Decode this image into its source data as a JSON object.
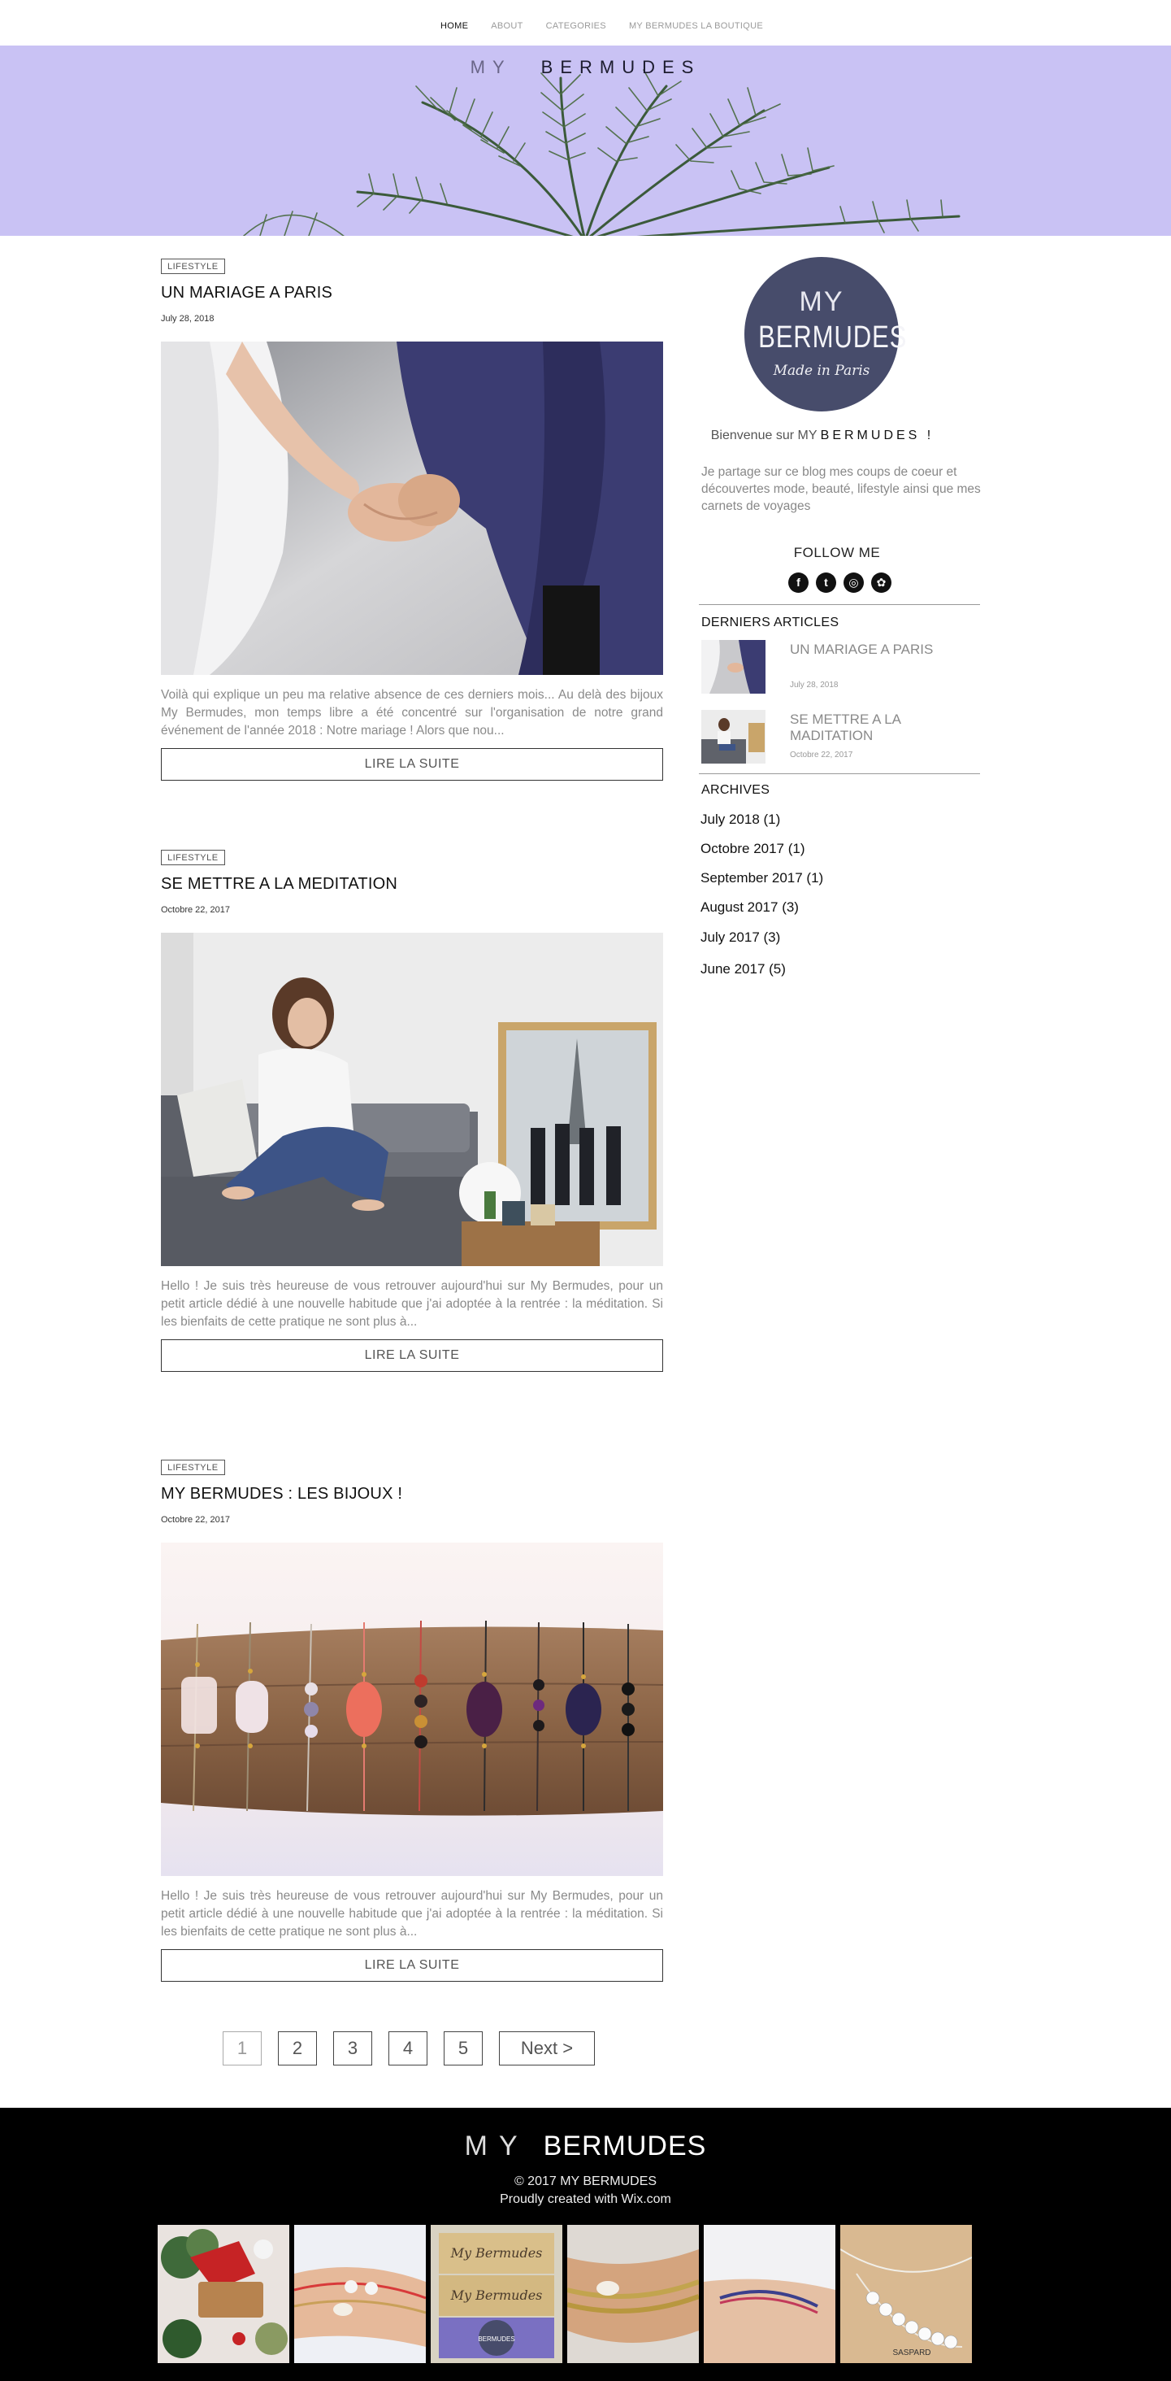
{
  "nav": {
    "items": [
      {
        "label": "HOME"
      },
      {
        "label": "ABOUT"
      },
      {
        "label": "CATEGORIES"
      },
      {
        "label": "MY BERMUDES LA BOUTIQUE"
      }
    ]
  },
  "hero": {
    "title_a": "MY",
    "title_b": "BERMUDES"
  },
  "posts": [
    {
      "category": "LIFESTYLE",
      "title": "UN MARIAGE A PARIS",
      "date": "July 28, 2018",
      "excerpt": "Voilà qui explique un peu ma relative absence de ces derniers mois... Au delà des bijoux My Bermudes, mon temps libre a été concentré sur l'organisation de notre grand événement de l'année 2018 : Notre mariage ! Alors que nou...",
      "read_more": "LIRE LA SUITE"
    },
    {
      "category": "LIFESTYLE",
      "title": "SE METTRE A LA MEDITATION",
      "date": "Octobre 22, 2017",
      "excerpt": "Hello ! Je suis très heureuse de vous retrouver aujourd'hui sur My Bermudes, pour un petit article dédié à une nouvelle habitude que j'ai adoptée à la rentrée : la méditation. Si les bienfaits de cette pratique ne sont plus à...",
      "read_more": "LIRE LA SUITE"
    },
    {
      "category": "LIFESTYLE",
      "title": "MY BERMUDES : LES BIJOUX !",
      "date": "Octobre 22, 2017",
      "excerpt": "Hello ! Je suis très heureuse de vous retrouver aujourd'hui sur My Bermudes, pour un petit article dédié à une nouvelle habitude que j'ai adoptée à la rentrée : la méditation. Si les bienfaits de cette pratique ne sont plus à...",
      "read_more": "LIRE LA SUITE"
    }
  ],
  "pagination": {
    "pages": [
      "1",
      "2",
      "3",
      "4",
      "5"
    ],
    "current": "1",
    "next": "Next >"
  },
  "sidebar": {
    "logo": {
      "line1": "MY",
      "line2": "BERMUDES",
      "line3": "Made in Paris"
    },
    "welcome_prefix": "Bienvenue sur MY",
    "welcome_brand": "BERMUDES !",
    "intro": "Je partage sur ce blog mes coups de coeur et découvertes mode, beauté, lifestyle ainsi que mes carnets de voyages",
    "follow": "FOLLOW ME",
    "socials": [
      {
        "icon": "facebook-icon",
        "glyph": "f"
      },
      {
        "icon": "twitter-icon",
        "glyph": "t"
      },
      {
        "icon": "instagram-icon",
        "glyph": "◎"
      },
      {
        "icon": "pinterest-icon",
        "glyph": "✿"
      }
    ],
    "recent_heading": "DERNIERS ARTICLES",
    "recent": [
      {
        "title": "UN MARIAGE A PARIS",
        "date": "July 28, 2018"
      },
      {
        "title": "SE METTRE A LA MADITATION",
        "date": "Octobre 22, 2017"
      }
    ],
    "archives_heading": "ARCHIVES",
    "archives": [
      {
        "label": "July 2018 (1)"
      },
      {
        "label": "Octobre 2017 (1)"
      },
      {
        "label": "September 2017 (1)"
      },
      {
        "label": "August 2017 (3)"
      },
      {
        "label": "July 2017 (3)"
      },
      {
        "label": "June 2017 (5)"
      }
    ]
  },
  "footer": {
    "title_a": "MY",
    "title_b": "BERMUDES",
    "copyright": "© 2017 MY BERMUDES",
    "credit": "Proudly created with Wix.com",
    "gallery_labels": [
      "My Bermudes",
      "My Bermudes",
      "BERMUDES",
      "SASPARD"
    ]
  },
  "colors": {
    "hero_bg": "#c9c2f4",
    "logo_bg": "#474c6b",
    "footer_bg": "#000000"
  }
}
